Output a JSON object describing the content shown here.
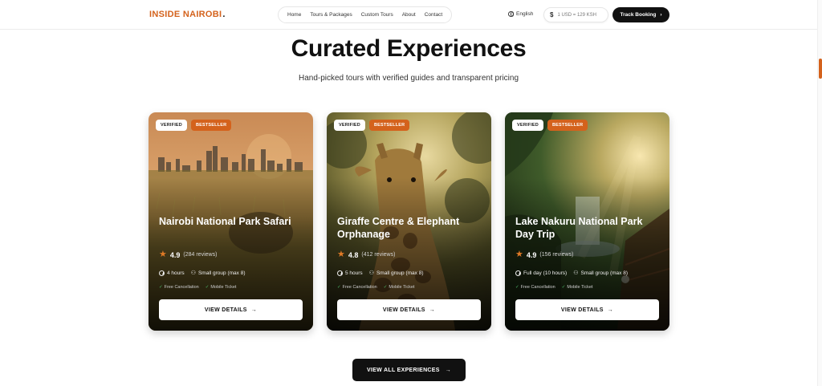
{
  "nav": {
    "logo": "INSIDE NAIROBI",
    "logo_dot": ".",
    "links": [
      "Home",
      "Tours & Packages",
      "Custom Tours",
      "About",
      "Contact"
    ],
    "language": "English",
    "currency_symbol": "$",
    "currency": "1 USD = 129 KSH",
    "track_button": "Track Booking",
    "track_arrow": "›"
  },
  "header": {
    "title": "Curated Experiences",
    "subtitle": "Hand-picked tours with verified guides and transparent pricing"
  },
  "cards": [
    {
      "badge_verified": "VERIFIED",
      "badge_bestseller": "BESTSELLER",
      "title": "Nairobi National Park Safari",
      "rating": "4.9",
      "reviews": "(284 reviews)",
      "duration": "4 hours",
      "group": "Small group (max 8)",
      "perk1": "Free Cancellation",
      "perk2": "Mobile Ticket",
      "button": "VIEW DETAILS"
    },
    {
      "badge_verified": "VERIFIED",
      "badge_bestseller": "BESTSELLER",
      "title": "Giraffe Centre & Elephant Orphanage",
      "rating": "4.8",
      "reviews": "(412 reviews)",
      "duration": "5 hours",
      "group": "Small group (max 8)",
      "perk1": "Free Cancellation",
      "perk2": "Mobile Ticket",
      "button": "VIEW DETAILS"
    },
    {
      "badge_verified": "VERIFIED",
      "badge_bestseller": "BESTSELLER",
      "title": "Lake Nakuru National Park Day Trip",
      "rating": "4.9",
      "reviews": "(156 reviews)",
      "duration": "Full day (10 hours)",
      "group": "Small group (max 8)",
      "perk1": "Free Cancellation",
      "perk2": "Mobile Ticket",
      "button": "VIEW DETAILS"
    }
  ],
  "view_all": "VIEW ALL EXPERIENCES",
  "icons": {
    "star": "★",
    "arrow": "→",
    "check": "✓",
    "users": "⚇"
  },
  "colors": {
    "accent": "#d4621c",
    "dark": "#111111"
  }
}
